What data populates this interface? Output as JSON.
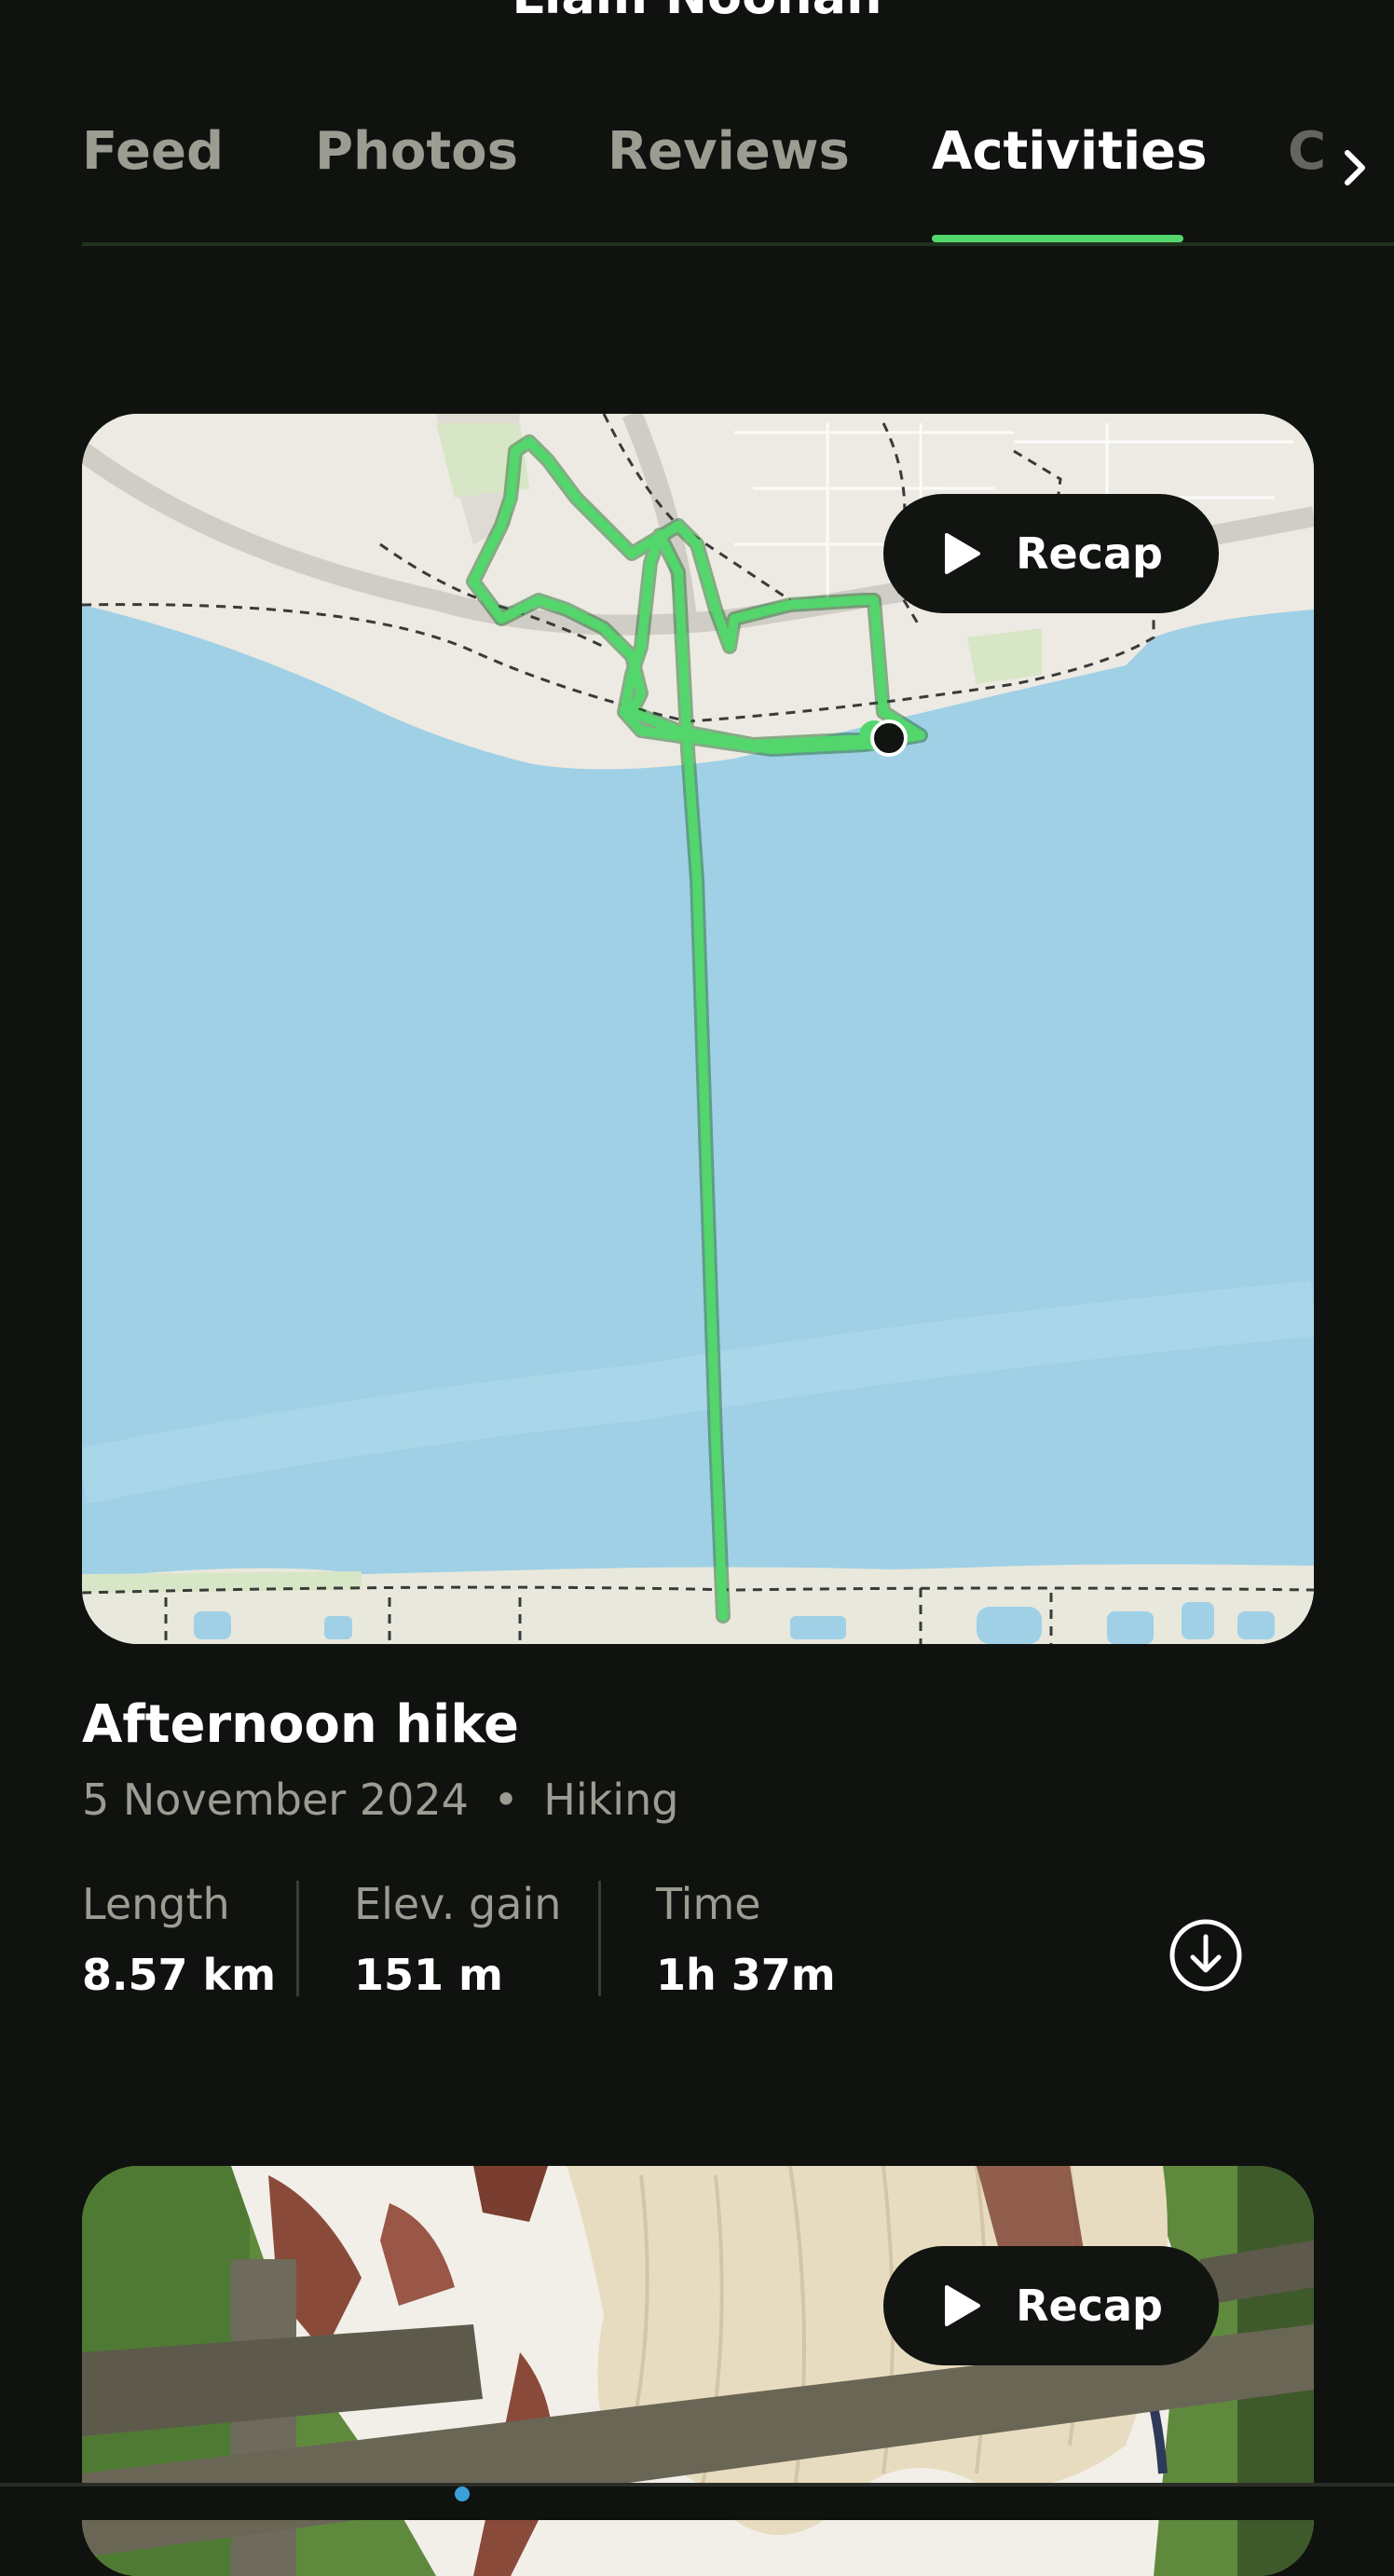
{
  "header": {
    "title": "Liam Noonan"
  },
  "tabs": [
    {
      "label": "Feed"
    },
    {
      "label": "Photos"
    },
    {
      "label": "Reviews"
    },
    {
      "label": "Activities"
    },
    {
      "label": "C"
    }
  ],
  "activity": {
    "recap_label": "Recap",
    "title": "Afternoon hike",
    "date": "5 November 2024",
    "separator": "•",
    "type": "Hiking",
    "stats": [
      {
        "label": "Length",
        "value": "8.57 km"
      },
      {
        "label": "Elev. gain",
        "value": "151 m"
      },
      {
        "label": "Time",
        "value": "1h 37m"
      }
    ]
  },
  "next_card": {
    "recap_label": "Recap"
  },
  "colors": {
    "background": "#0f120e",
    "accent": "#53d66c",
    "water": "#9fd0e6",
    "land": "#eceae2"
  },
  "icons": [
    "gear-icon",
    "chevron-right-icon",
    "play-icon",
    "download-icon"
  ]
}
